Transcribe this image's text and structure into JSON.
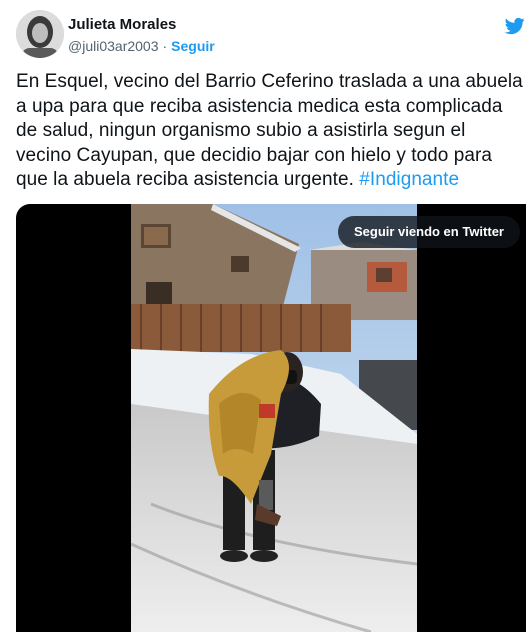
{
  "author": {
    "display_name": "Julieta Morales",
    "handle": "@juli03ar2003",
    "separator": "·",
    "follow_label": "Seguir"
  },
  "tweet": {
    "text": "En Esquel, vecino del Barrio Ceferino traslada a una abuela a upa para que reciba asistencia medica esta complicada de salud, ningun organismo subio  a asistirla segun el vecino Cayupan, que decidio bajar con hielo y todo para que la abuela reciba asistencia urgente.",
    "hashtag": "#Indignante"
  },
  "media": {
    "keep_watching_label": "Seguir viendo en Twitter"
  },
  "icons": {
    "brand": "twitter-bird-icon"
  },
  "colors": {
    "brand_blue": "#1d9bf0",
    "text": "#0f1419",
    "muted": "#536471"
  }
}
